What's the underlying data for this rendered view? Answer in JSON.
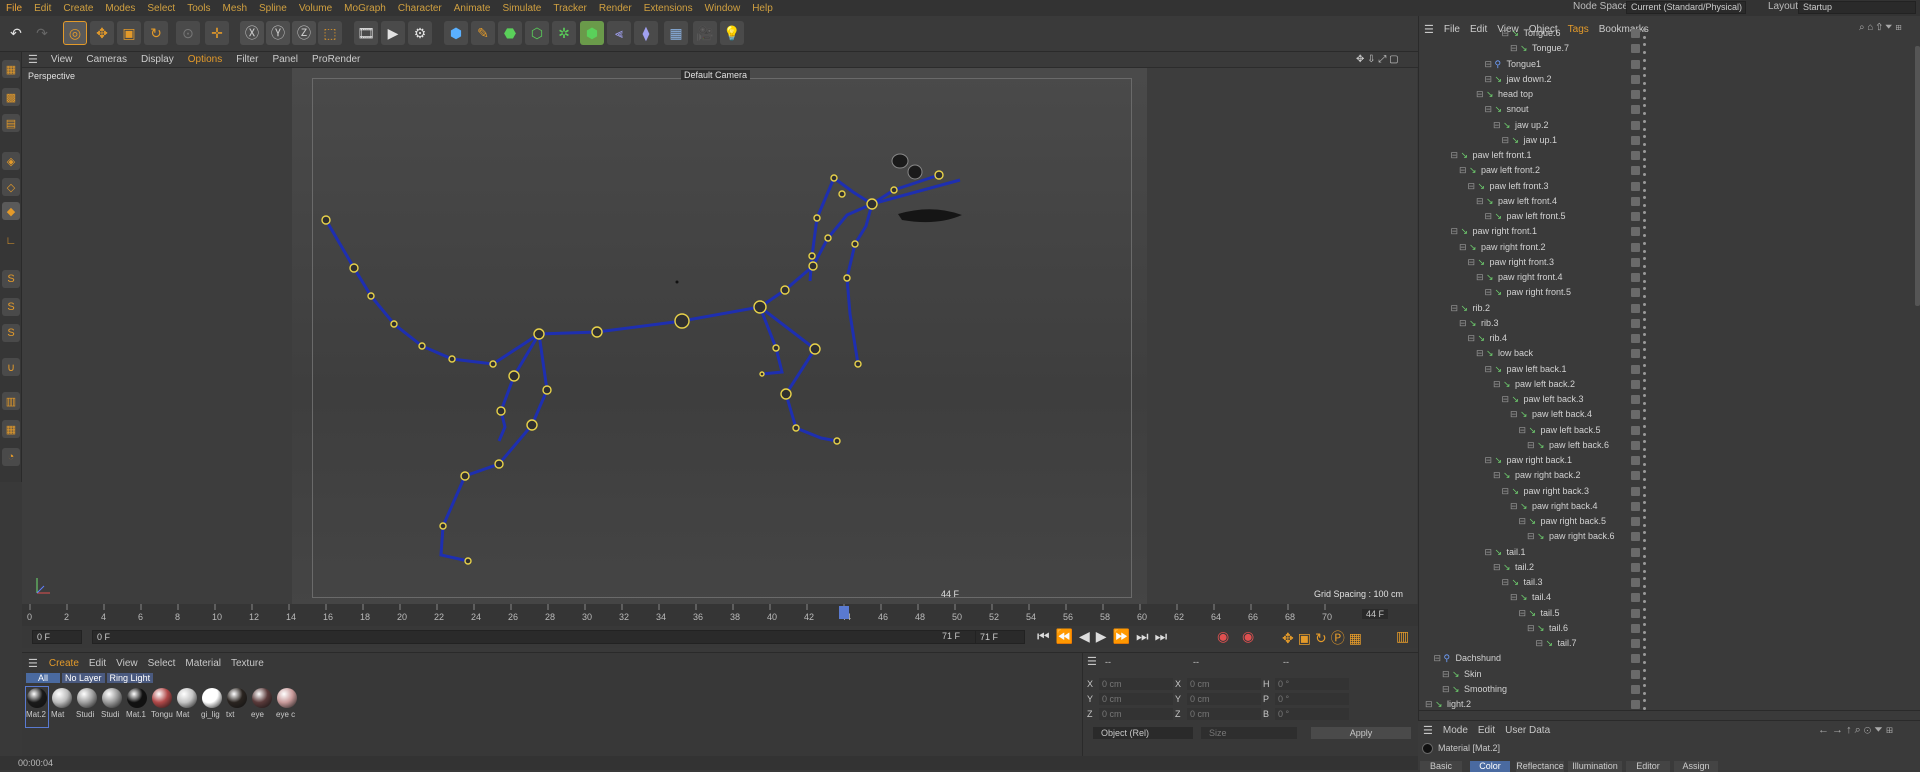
{
  "menubar": {
    "items": [
      "File",
      "Edit",
      "Create",
      "Modes",
      "Select",
      "Tools",
      "Mesh",
      "Spline",
      "Volume",
      "MoGraph",
      "Character",
      "Animate",
      "Simulate",
      "Tracker",
      "Render",
      "Extensions",
      "Window",
      "Help"
    ],
    "node_space_label": "Node Space:",
    "node_space_value": "Current (Standard/Physical)",
    "layout_label": "Layout:",
    "layout_value": "Startup"
  },
  "viewport": {
    "menu": [
      "View",
      "Cameras",
      "Display",
      "Options",
      "Filter",
      "Panel",
      "ProRender"
    ],
    "name": "Perspective",
    "camera": "Default Camera",
    "frame": "44 F",
    "grid": "Grid Spacing : 100 cm"
  },
  "timeline": {
    "ticks": [
      "0",
      "2",
      "4",
      "6",
      "8",
      "10",
      "12",
      "14",
      "16",
      "18",
      "20",
      "22",
      "24",
      "26",
      "28",
      "30",
      "32",
      "34",
      "36",
      "38",
      "40",
      "42",
      "44",
      "46",
      "48",
      "50",
      "52",
      "54",
      "56",
      "58",
      "60",
      "62",
      "64",
      "66",
      "68",
      "70"
    ],
    "current": "44 F",
    "playhead": 44
  },
  "transport": {
    "start": "0 F",
    "range_start": "0 F",
    "range_end": "71 F",
    "end": "71 F"
  },
  "material_panel": {
    "menu": [
      "Create",
      "Edit",
      "View",
      "Select",
      "Material",
      "Texture"
    ],
    "filters": [
      "All",
      "No Layer",
      "Ring Light"
    ],
    "materials": [
      {
        "name": "Mat.2",
        "color": "#1a1a1a"
      },
      {
        "name": "Mat",
        "color": "#bdbdbd"
      },
      {
        "name": "Studi",
        "color": "#a0a0a0"
      },
      {
        "name": "Studi",
        "color": "#9a9a9a"
      },
      {
        "name": "Mat.1",
        "color": "#111"
      },
      {
        "name": "Tongu",
        "color": "#b04848"
      },
      {
        "name": "Mat",
        "color": "#c4c4c4"
      },
      {
        "name": "gi_lig",
        "color": "#ffffff"
      },
      {
        "name": "txt",
        "color": "#2a2420"
      },
      {
        "name": "eye",
        "color": "#5a3a3a"
      },
      {
        "name": "eye c",
        "color": "#c89a9a"
      }
    ]
  },
  "coords": {
    "header_dashes": [
      "--",
      "--",
      "--"
    ],
    "rows": [
      {
        "a": "X",
        "av": "0 cm",
        "b": "X",
        "bv": "0 cm",
        "c": "H",
        "cv": "0 °"
      },
      {
        "a": "Y",
        "av": "0 cm",
        "b": "Y",
        "bv": "0 cm",
        "c": "P",
        "cv": "0 °"
      },
      {
        "a": "Z",
        "av": "0 cm",
        "b": "Z",
        "bv": "0 cm",
        "c": "B",
        "cv": "0 °"
      }
    ],
    "mode": "Object (Rel)",
    "size": "Size",
    "apply": "Apply"
  },
  "status": "00:00:04",
  "object_manager": {
    "menu": [
      "File",
      "Edit",
      "View",
      "Object",
      "Tags",
      "Bookmarks"
    ],
    "rows": [
      {
        "label": "Tongue.6",
        "indent": 8
      },
      {
        "label": "Tongue.7",
        "indent": 9
      },
      {
        "label": "Tongue1",
        "indent": 6,
        "icon": "figure"
      },
      {
        "label": "jaw down.2",
        "indent": 6
      },
      {
        "label": "head top",
        "indent": 5
      },
      {
        "label": "snout",
        "indent": 6
      },
      {
        "label": "jaw up.2",
        "indent": 7
      },
      {
        "label": "jaw up.1",
        "indent": 8
      },
      {
        "label": "paw left front.1",
        "indent": 2
      },
      {
        "label": "paw left front.2",
        "indent": 3
      },
      {
        "label": "paw left front.3",
        "indent": 4
      },
      {
        "label": "paw left front.4",
        "indent": 5
      },
      {
        "label": "paw left front.5",
        "indent": 6
      },
      {
        "label": "paw right front.1",
        "indent": 2
      },
      {
        "label": "paw right front.2",
        "indent": 3
      },
      {
        "label": "paw right front.3",
        "indent": 4
      },
      {
        "label": "paw right front.4",
        "indent": 5
      },
      {
        "label": "paw right front.5",
        "indent": 6
      },
      {
        "label": "rib.2",
        "indent": 2
      },
      {
        "label": "rib.3",
        "indent": 3
      },
      {
        "label": "rib.4",
        "indent": 4
      },
      {
        "label": "low back",
        "indent": 5
      },
      {
        "label": "paw left back.1",
        "indent": 6
      },
      {
        "label": "paw left back.2",
        "indent": 7
      },
      {
        "label": "paw left back.3",
        "indent": 8
      },
      {
        "label": "paw left back.4",
        "indent": 9
      },
      {
        "label": "paw left back.5",
        "indent": 10
      },
      {
        "label": "paw left back.6",
        "indent": 11
      },
      {
        "label": "paw right back.1",
        "indent": 6
      },
      {
        "label": "paw right back.2",
        "indent": 7
      },
      {
        "label": "paw right back.3",
        "indent": 8
      },
      {
        "label": "paw right back.4",
        "indent": 9
      },
      {
        "label": "paw right back.5",
        "indent": 10
      },
      {
        "label": "paw right back.6",
        "indent": 11
      },
      {
        "label": "tail.1",
        "indent": 6
      },
      {
        "label": "tail.2",
        "indent": 7
      },
      {
        "label": "tail.3",
        "indent": 8
      },
      {
        "label": "tail.4",
        "indent": 9
      },
      {
        "label": "tail.5",
        "indent": 10
      },
      {
        "label": "tail.6",
        "indent": 11
      },
      {
        "label": "tail.7",
        "indent": 12
      },
      {
        "label": "Dachshund",
        "indent": 0,
        "icon": "figure"
      },
      {
        "label": "Skin",
        "indent": 1
      },
      {
        "label": "Smoothing",
        "indent": 1
      },
      {
        "label": "light.2",
        "indent": -1
      }
    ]
  },
  "attributes": {
    "menu": [
      "Mode",
      "Edit",
      "User Data"
    ],
    "title": "Material [Mat.2]",
    "tabs": [
      "Basic",
      "Color",
      "Reflectance",
      "Illumination",
      "Editor",
      "Assign"
    ],
    "active_tab": "Color"
  },
  "colors": {
    "accent": "#e39a2a",
    "bone": "#1e2fb0",
    "joint": "#e8d24a"
  }
}
